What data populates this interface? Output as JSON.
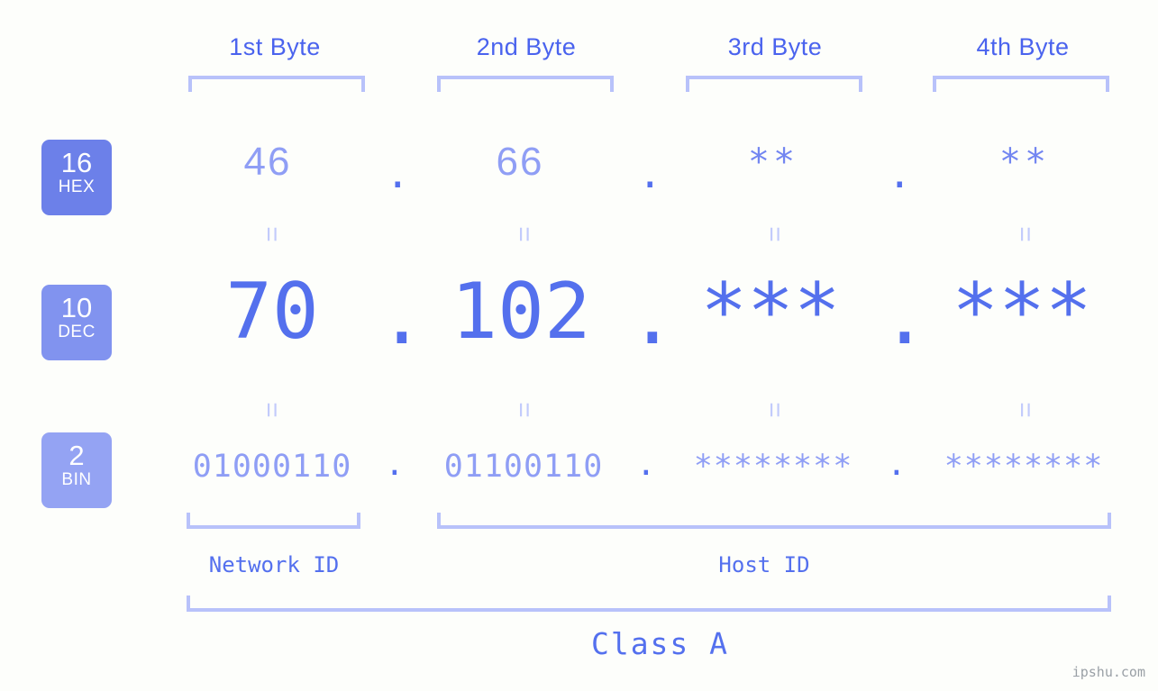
{
  "meta": {
    "background_color": "#fdfefb",
    "accent_color": "#5470ed",
    "accent_light_color": "#8f9ef5",
    "bracket_color": "#b8c2fa",
    "watermark": "ipshu.com"
  },
  "byte_headers": [
    {
      "label": "1st Byte"
    },
    {
      "label": "2nd Byte"
    },
    {
      "label": "3rd Byte"
    },
    {
      "label": "4th Byte"
    }
  ],
  "bases": [
    {
      "num": "16",
      "name": "HEX",
      "color": "#6c80e9"
    },
    {
      "num": "10",
      "name": "DEC",
      "color": "#8193ef"
    },
    {
      "num": "2",
      "name": "BIN",
      "color": "#94a3f3"
    }
  ],
  "rows": {
    "hex": {
      "base_num": "16",
      "base_name": "HEX",
      "values": [
        "46",
        "66",
        "**",
        "**"
      ],
      "separators": [
        ".",
        ".",
        "."
      ]
    },
    "dec": {
      "base_num": "10",
      "base_name": "DEC",
      "values": [
        "70",
        "102",
        "***",
        "***"
      ],
      "separators": [
        ".",
        ".",
        "."
      ]
    },
    "bin": {
      "base_num": "2",
      "base_name": "BIN",
      "values": [
        "01000110",
        "01100110",
        "********",
        "********"
      ],
      "separators": [
        ".",
        ".",
        "."
      ]
    }
  },
  "equality_marks": {
    "symbol": "=",
    "hex_to_dec": [
      "=",
      "=",
      "=",
      "="
    ],
    "dec_to_bin": [
      "=",
      "=",
      "=",
      "="
    ]
  },
  "id_sections": [
    {
      "label": "Network ID"
    },
    {
      "label": "Host ID"
    }
  ],
  "class_section": {
    "label": "Class A"
  }
}
